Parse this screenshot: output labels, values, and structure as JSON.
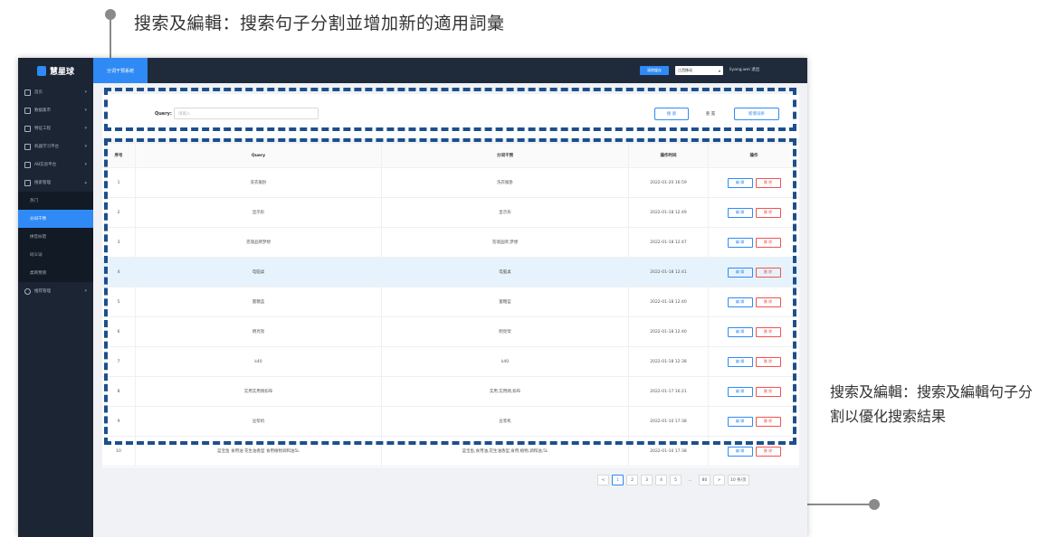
{
  "annotations": {
    "top": "搜索及編輯：搜索句子分割並增加新的適用詞彙",
    "right": "搜索及編輯：搜索及編輯句子分割以優化搜索結果"
  },
  "sidebar": {
    "logo": "慧星球",
    "items": [
      {
        "label": "首页",
        "icon": "home-icon"
      },
      {
        "label": "数据集市",
        "icon": "document-icon"
      },
      {
        "label": "特征工程",
        "icon": "filter-icon"
      },
      {
        "label": "机器学习平台",
        "icon": "monitor-icon"
      },
      {
        "label": "AB实验平台",
        "icon": "users-icon"
      },
      {
        "label": "搜索管理",
        "icon": "search-icon"
      }
    ],
    "sub_items": [
      "热门",
      "分词干预",
      "拼音纠错",
      "同义词",
      "类目预测"
    ],
    "last_item": {
      "label": "推荐管理",
      "icon": "refresh-icon"
    }
  },
  "topbar": {
    "tab": "分词干预系统",
    "button": "清除缓存",
    "select": "江西移动",
    "user": "liyang.wei  退出"
  },
  "search": {
    "label": "Query:",
    "placeholder": "请输入",
    "search_btn": "搜 索",
    "reset_btn": "重 置",
    "add_btn": "新增词条"
  },
  "table": {
    "headers": [
      "序号",
      "Query",
      "分词干预",
      "操作时间",
      "操作"
    ],
    "edit_label": "编 辑",
    "delete_label": "删 除",
    "rows": [
      {
        "idx": "1",
        "query": "洗衣服卧",
        "seg": "洗衣服卧",
        "time": "2022-01-20 16:59"
      },
      {
        "idx": "2",
        "query": "显示形",
        "seg": "显示形",
        "time": "2022-01-18 12:49"
      },
      {
        "idx": "3",
        "query": "克瑞品牌梦想",
        "seg": "克瑞品牌,梦想",
        "time": "2022-01-18 12:47"
      },
      {
        "idx": "4",
        "query": "电脑桌",
        "seg": "电脑桌",
        "time": "2022-01-18 12:41"
      },
      {
        "idx": "5",
        "query": "蜜糖蓝",
        "seg": "蜜糖蓝",
        "time": "2022-01-18 12:40"
      },
      {
        "idx": "6",
        "query": "明亮架",
        "seg": "明亮架",
        "time": "2022-01-18 12:40"
      },
      {
        "idx": "7",
        "query": "k40",
        "seg": "k40",
        "time": "2022-01-18 12:38"
      },
      {
        "idx": "8",
        "query": "实用实用绸扣布",
        "seg": "实用,实用绸,扣布",
        "time": "2022-01-17 16:21"
      },
      {
        "idx": "9",
        "query": "豆浆机",
        "seg": "豆浆机",
        "time": "2022-01-10 17:38"
      },
      {
        "idx": "10",
        "query": "蓝宝鱼 食用油 花生油香型 食用植物调和油5L",
        "seg": "蓝宝鱼,食用油,花生油香型,食用,植物,调和油,5L",
        "time": "2022-01-10 17:38"
      }
    ],
    "highlight_row": 3
  },
  "pager": {
    "prev": "<",
    "pages": [
      "1",
      "2",
      "3",
      "4",
      "5"
    ],
    "ellipsis": "…",
    "last": "80",
    "next": ">",
    "size": "10 条/页"
  }
}
